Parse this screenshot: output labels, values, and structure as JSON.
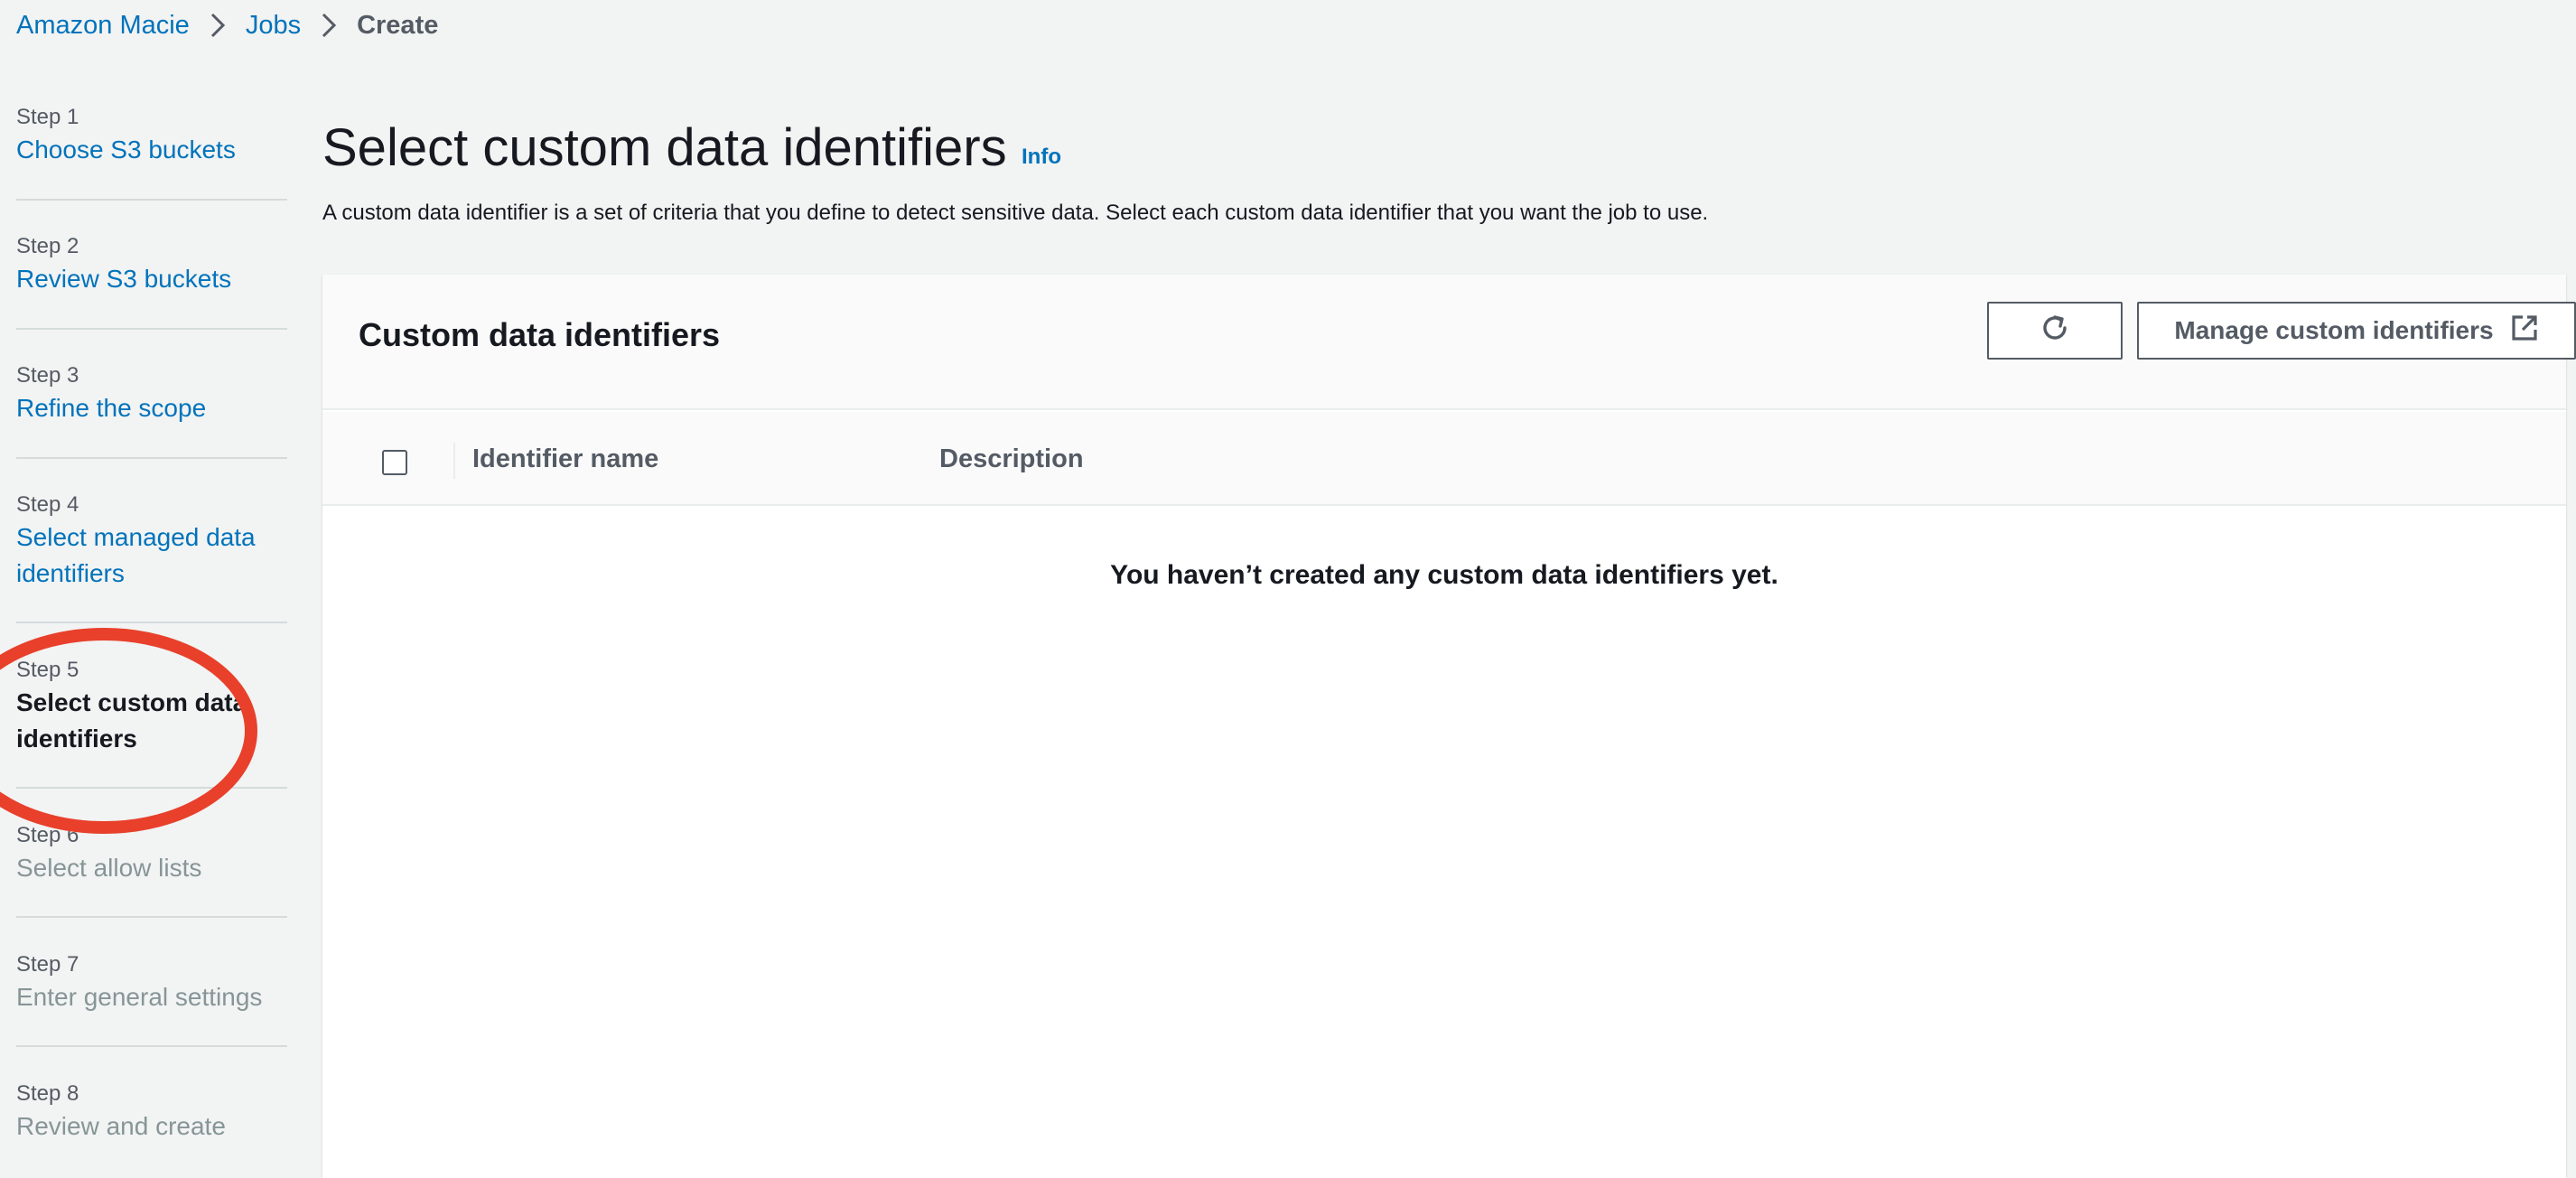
{
  "breadcrumb": {
    "items": [
      {
        "label": "Amazon Macie"
      },
      {
        "label": "Jobs"
      },
      {
        "label": "Create"
      }
    ]
  },
  "steps": [
    {
      "number": "Step 1",
      "title": "Choose S3 buckets",
      "state": "link"
    },
    {
      "number": "Step 2",
      "title": "Review S3 buckets",
      "state": "link"
    },
    {
      "number": "Step 3",
      "title": "Refine the scope",
      "state": "link"
    },
    {
      "number": "Step 4",
      "title_lines": [
        "Select managed data",
        "identifiers"
      ],
      "state": "link"
    },
    {
      "number": "Step 5",
      "title_lines": [
        "Select custom data",
        "identifiers"
      ],
      "state": "current"
    },
    {
      "number": "Step 6",
      "title": "Select allow lists",
      "state": "disabled"
    },
    {
      "number": "Step 7",
      "title": "Enter general settings",
      "state": "disabled"
    },
    {
      "number": "Step 8",
      "title": "Review and create",
      "state": "disabled"
    }
  ],
  "header": {
    "title": "Select custom data identifiers",
    "info_label": "Info",
    "description": "A custom data identifier is a set of criteria that you define to detect sensitive data. Select each custom data identifier that you want the job to use."
  },
  "panel": {
    "title": "Custom data identifiers",
    "refresh_icon": "refresh-icon",
    "manage_button_label": "Manage custom identifiers",
    "manage_icon": "external-link-icon",
    "columns": [
      "Identifier name",
      "Description"
    ],
    "empty_message": "You haven’t created any custom data identifiers yet."
  },
  "colors": {
    "link": "#0073bb",
    "text": "#16191f",
    "secondary": "#545b64",
    "disabled": "#879596",
    "background": "#f2f3f3",
    "annotation": "#e8402b"
  }
}
